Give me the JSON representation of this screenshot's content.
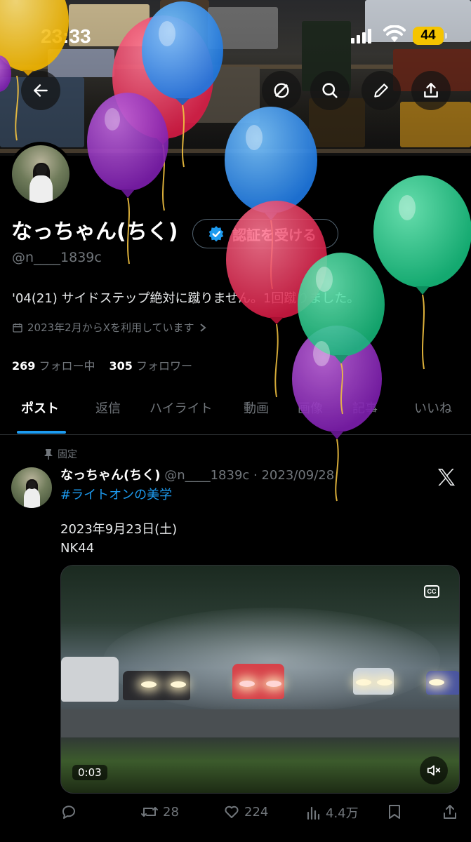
{
  "status_bar": {
    "time": "23:33",
    "battery": "44"
  },
  "profile": {
    "display_name": "なっちゃん(ちく)",
    "verify_label": "認証を受ける",
    "handle": "@n____1839c",
    "bio": "'04(21) サイドステップ絶対に蹴りません。1回蹴りました。",
    "joined": "2023年2月からXを利用しています",
    "following_count": "269",
    "following_label": "フォロー中",
    "followers_count": "305",
    "followers_label": "フォロワー"
  },
  "tabs": [
    "ポスト",
    "返信",
    "ハイライト",
    "動画",
    "画像",
    "記事",
    "いいね"
  ],
  "post": {
    "pinned_label": "固定",
    "author_name": "なっちゃん(ちく)",
    "author_meta": "@n____1839c · 2023/09/28",
    "hashtag": "#ライトオンの美学",
    "text_line1": "2023年9月23日(土)",
    "text_line2": "NK44",
    "video": {
      "duration": "0:03",
      "cc_label": "CC"
    },
    "replies": "",
    "reposts": "28",
    "likes": "224",
    "views": "4.4万"
  },
  "colors": {
    "accent": "#1d9bf0",
    "muted": "#71767b",
    "background": "#000000",
    "battery": "#f5c400"
  }
}
